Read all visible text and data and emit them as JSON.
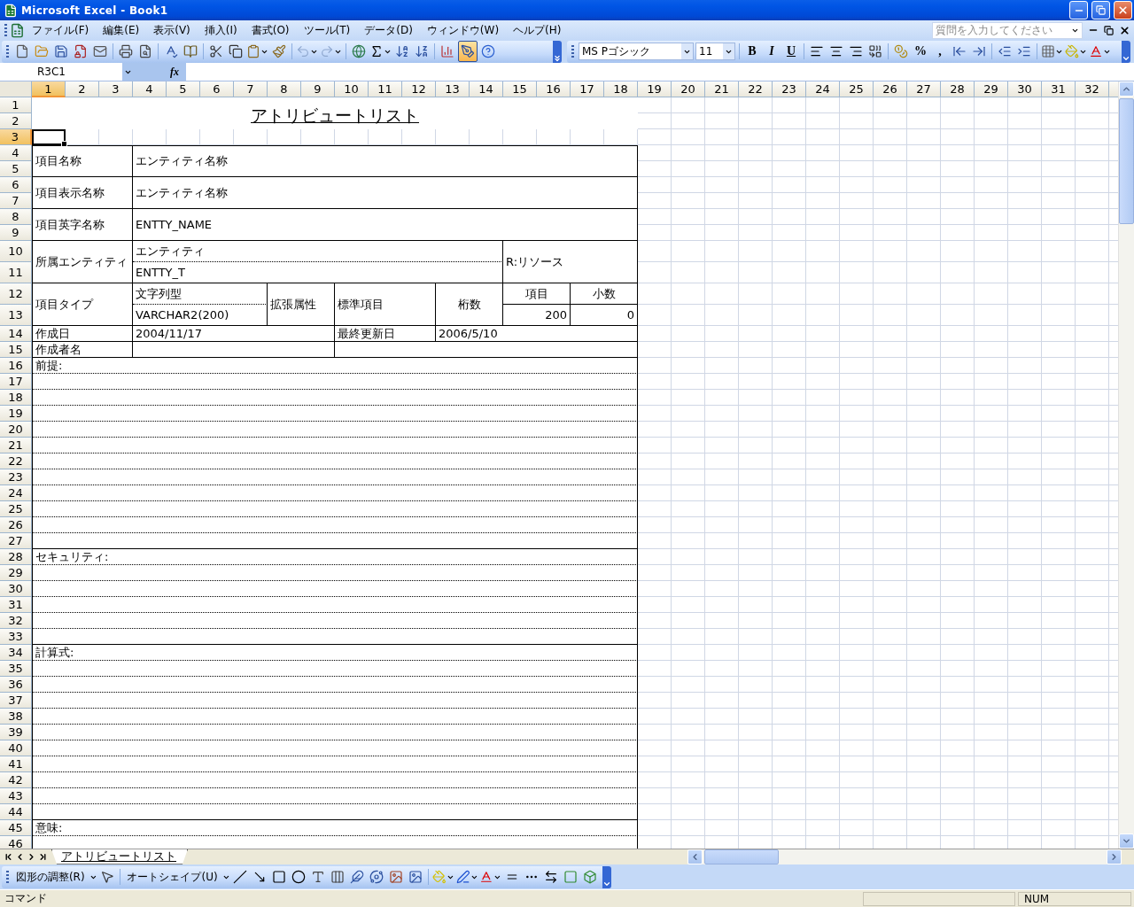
{
  "window": {
    "title": "Microsoft Excel - Book1"
  },
  "menu": [
    "ファイル(F)",
    "編集(E)",
    "表示(V)",
    "挿入(I)",
    "書式(O)",
    "ツール(T)",
    "データ(D)",
    "ウィンドウ(W)",
    "ヘルプ(H)"
  ],
  "help_search": {
    "placeholder": "質問を入力してください"
  },
  "standard_toolbar": {
    "drawing_on": true
  },
  "formatting": {
    "font": "MS Pゴシック",
    "size": "11",
    "style_buttons": [
      "B",
      "I",
      "U"
    ],
    "number_buttons": [
      "%",
      ","
    ]
  },
  "formula_bar": {
    "name_box": "R3C1",
    "function_label": "fx"
  },
  "columns": [
    {
      "label": "1",
      "selected": true
    },
    {
      "label": "2",
      "selected": false
    },
    {
      "label": "3",
      "selected": false
    },
    {
      "label": "4",
      "selected": false
    },
    {
      "label": "5",
      "selected": false
    },
    {
      "label": "6",
      "selected": false
    },
    {
      "label": "7",
      "selected": false
    },
    {
      "label": "8",
      "selected": false
    },
    {
      "label": "9",
      "selected": false
    },
    {
      "label": "10",
      "selected": false
    },
    {
      "label": "11",
      "selected": false
    },
    {
      "label": "12",
      "selected": false
    },
    {
      "label": "13",
      "selected": false
    },
    {
      "label": "14",
      "selected": false
    },
    {
      "label": "15",
      "selected": false
    },
    {
      "label": "16",
      "selected": false
    },
    {
      "label": "17",
      "selected": false
    },
    {
      "label": "18",
      "selected": false
    },
    {
      "label": "19",
      "selected": false
    },
    {
      "label": "20",
      "selected": false
    },
    {
      "label": "21",
      "selected": false
    },
    {
      "label": "22",
      "selected": false
    },
    {
      "label": "23",
      "selected": false
    },
    {
      "label": "24",
      "selected": false
    },
    {
      "label": "25",
      "selected": false
    },
    {
      "label": "26",
      "selected": false
    },
    {
      "label": "27",
      "selected": false
    },
    {
      "label": "28",
      "selected": false
    },
    {
      "label": "29",
      "selected": false
    },
    {
      "label": "30",
      "selected": false
    },
    {
      "label": "31",
      "selected": false
    },
    {
      "label": "32",
      "selected": false
    }
  ],
  "rows": [
    {
      "label": "1",
      "selected": false
    },
    {
      "label": "2",
      "selected": false
    },
    {
      "label": "3",
      "selected": true
    },
    {
      "label": "4",
      "selected": false
    },
    {
      "label": "5",
      "selected": false
    },
    {
      "label": "6",
      "selected": false
    },
    {
      "label": "7",
      "selected": false
    },
    {
      "label": "8",
      "selected": false
    },
    {
      "label": "9",
      "selected": false
    },
    {
      "label": "10",
      "selected": false
    },
    {
      "label": "11",
      "selected": false
    },
    {
      "label": "12",
      "selected": false
    },
    {
      "label": "13",
      "selected": false
    },
    {
      "label": "14",
      "selected": false
    },
    {
      "label": "15",
      "selected": false
    },
    {
      "label": "16",
      "selected": false
    },
    {
      "label": "17",
      "selected": false
    },
    {
      "label": "18",
      "selected": false
    },
    {
      "label": "19",
      "selected": false
    },
    {
      "label": "20",
      "selected": false
    },
    {
      "label": "21",
      "selected": false
    },
    {
      "label": "22",
      "selected": false
    },
    {
      "label": "23",
      "selected": false
    },
    {
      "label": "24",
      "selected": false
    },
    {
      "label": "25",
      "selected": false
    },
    {
      "label": "26",
      "selected": false
    },
    {
      "label": "27",
      "selected": false
    },
    {
      "label": "28",
      "selected": false
    },
    {
      "label": "29",
      "selected": false
    },
    {
      "label": "30",
      "selected": false
    },
    {
      "label": "31",
      "selected": false
    },
    {
      "label": "32",
      "selected": false
    },
    {
      "label": "33",
      "selected": false
    },
    {
      "label": "34",
      "selected": false
    },
    {
      "label": "35",
      "selected": false
    },
    {
      "label": "36",
      "selected": false
    },
    {
      "label": "37",
      "selected": false
    },
    {
      "label": "38",
      "selected": false
    },
    {
      "label": "39",
      "selected": false
    },
    {
      "label": "40",
      "selected": false
    },
    {
      "label": "41",
      "selected": false
    },
    {
      "label": "42",
      "selected": false
    },
    {
      "label": "43",
      "selected": false
    },
    {
      "label": "44",
      "selected": false
    },
    {
      "label": "45",
      "selected": false
    },
    {
      "label": "46",
      "selected": false
    }
  ],
  "form": {
    "title": "アトリビュートリスト",
    "item_name": {
      "label": "項目名称",
      "value": "エンティティ名称"
    },
    "display_name": {
      "label": "項目表示名称",
      "value": "エンティティ名称"
    },
    "english_name": {
      "label": "項目英字名称",
      "value": "ENTTY_NAME"
    },
    "entity": {
      "label": "所属エンティティ",
      "name": "エンティティ",
      "code": "ENTTY_T",
      "category": "R:リソース"
    },
    "item_type": {
      "label": "項目タイプ",
      "type_name": "文字列型",
      "type_def": "VARCHAR2(200)",
      "extended": "拡張属性",
      "standard": "標準項目",
      "digits": "桁数",
      "length_header": "項目",
      "decimal_header": "小数",
      "length": "200",
      "decimals": "0"
    },
    "created": {
      "label": "作成日",
      "value": "2004/11/17"
    },
    "updated": {
      "label": "最終更新日",
      "value": "2006/5/10"
    },
    "author": {
      "label": "作成者名"
    },
    "sections": [
      {
        "label": "前提:"
      },
      {
        "label": "セキュリティ:"
      },
      {
        "label": "計算式:"
      },
      {
        "label": "意味:"
      }
    ]
  },
  "sheet_tabs": [
    {
      "label": "アトリビュートリスト",
      "selected": true
    }
  ],
  "drawing_toolbar": {
    "arrange_menu": "図形の調整(R)",
    "autoshape_menu": "オートシェイプ(U)"
  },
  "status_bar": {
    "mode": "コマンド",
    "num_lock": "NUM"
  }
}
